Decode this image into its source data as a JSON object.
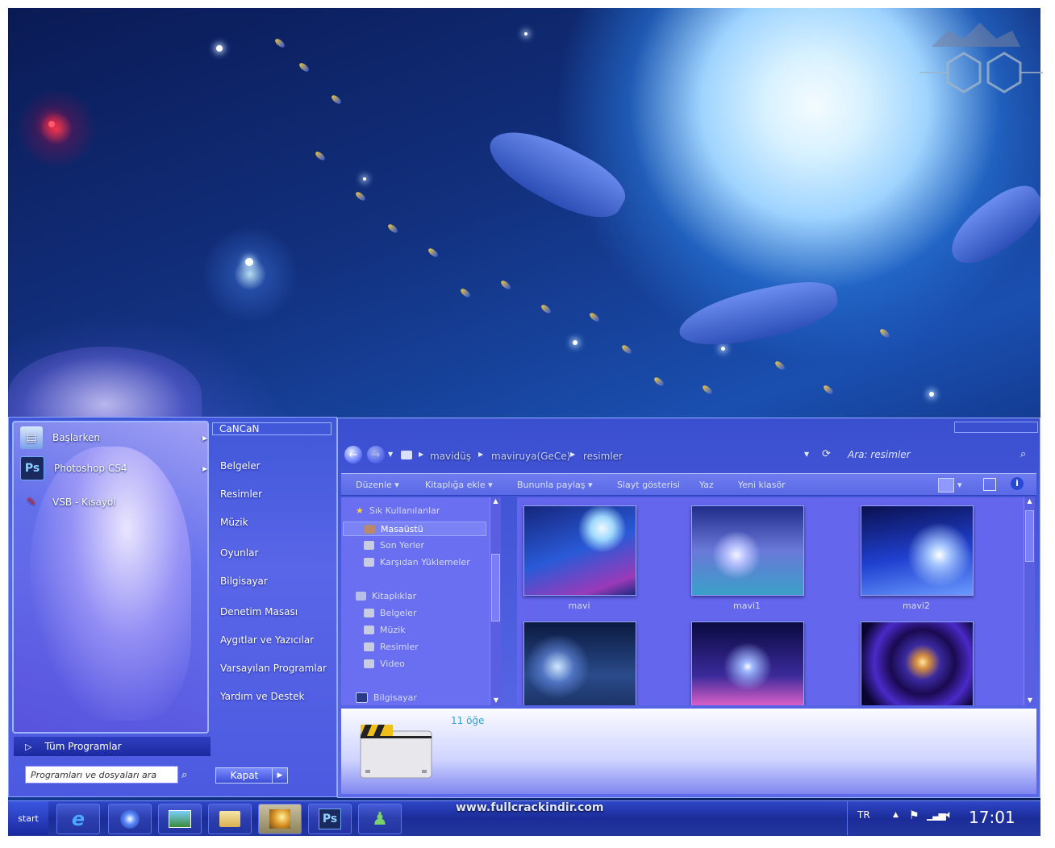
{
  "start_menu": {
    "pinned": [
      {
        "label": "Başlarken",
        "icon": "getting-started-icon"
      },
      {
        "label": "Photoshop CS4",
        "icon": "photoshop-icon",
        "icon_text": "Ps"
      },
      {
        "label": "VSB - Kısayol",
        "icon": "vsb-shortcut-icon"
      }
    ],
    "all_programs": "Tüm Programlar",
    "search_placeholder": "Programları ve dosyaları ara",
    "user_name": "CaNCaN",
    "right_links": [
      "Belgeler",
      "Resimler",
      "Müzik",
      "Oyunlar",
      "Bilgisayar",
      "Denetim Masası",
      "Aygıtlar ve Yazıcılar",
      "Varsayılan Programlar",
      "Yardım ve Destek"
    ],
    "shutdown": "Kapat"
  },
  "explorer": {
    "breadcrumb": [
      "mavidüş",
      "maviruya(GeCe)",
      "resimler"
    ],
    "search_placeholder": "Ara: resimler",
    "commands": [
      "Düzenle",
      "Kitaplığa ekle",
      "Bununla paylaş",
      "Slayt gösterisi",
      "Yaz",
      "Yeni klasör"
    ],
    "nav": {
      "favorites": "Sık Kullanılanlar",
      "favorites_items": [
        "Masaüstü",
        "Son Yerler",
        "Karşıdan Yüklemeler"
      ],
      "libraries": "Kitaplıklar",
      "libraries_items": [
        "Belgeler",
        "Müzik",
        "Resimler",
        "Video"
      ],
      "computer": "Bilgisayar"
    },
    "files": [
      "mavi",
      "mavi1",
      "mavi2"
    ],
    "item_count": "11 öğe"
  },
  "taskbar": {
    "start_label": "start",
    "website": "www.fullcrackindir.com",
    "photoshop_text": "Ps",
    "language": "TR",
    "clock": "17:01"
  },
  "colors": {
    "accent": "#3a4fd0",
    "taskbar": "#1b2c98",
    "content_bg": "#6466ee"
  }
}
